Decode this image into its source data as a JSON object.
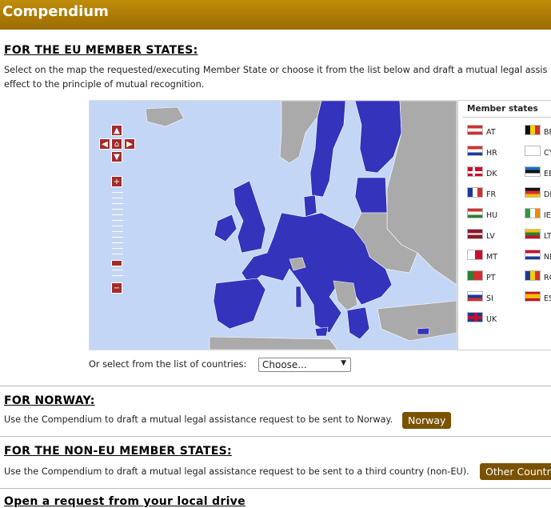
{
  "app": {
    "title": "Compendium"
  },
  "eu": {
    "heading": "FOR THE EU MEMBER STATES:",
    "desc_line1": "Select on the map the requested/executing Member State or choose it from the list below and draft a mutual legal assis",
    "desc_line2": "effect to the principle of mutual recognition."
  },
  "legend": {
    "title": "Member states",
    "col1": [
      "AT",
      "HR",
      "DK",
      "FR",
      "HU",
      "LV",
      "MT",
      "PT",
      "SI",
      "UK"
    ],
    "col2": [
      "BE",
      "CY",
      "EE",
      "DE",
      "IE",
      "LT",
      "NL",
      "RO",
      "ES"
    ]
  },
  "select": {
    "label": "Or select from the list of countries:",
    "value": "Choose..."
  },
  "norway": {
    "heading": "FOR NORWAY:",
    "desc": "Use the Compendium to draft a mutual legal assistance request to be sent to Norway.",
    "button": "Norway"
  },
  "noneu": {
    "heading": "FOR THE NON-EU MEMBER STATES:",
    "desc": "Use the Compendium to draft a mutual legal assistance request to be sent to a third country (non-EU).",
    "button": "Other Countri"
  },
  "local": {
    "heading": "Open a request from your local drive"
  },
  "map": {
    "zoom_in": "+",
    "zoom_out": "−",
    "colors": {
      "eu": "#3333bb",
      "non_eu": "#aaaaaa",
      "sea": "#c4d6f5",
      "accent": "#a52a2a"
    },
    "nav_icons": [
      "up-arrow-icon",
      "left-arrow-icon",
      "home-icon",
      "right-arrow-icon",
      "down-arrow-icon"
    ]
  }
}
